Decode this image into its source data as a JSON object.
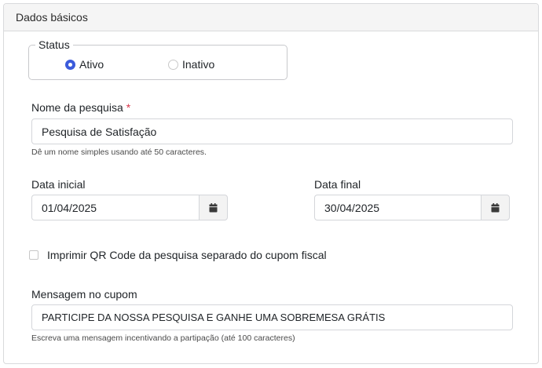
{
  "panel": {
    "title": "Dados básicos"
  },
  "status": {
    "legend": "Status",
    "options": [
      {
        "label": "Ativo",
        "selected": true
      },
      {
        "label": "Inativo",
        "selected": false
      }
    ]
  },
  "survey_name": {
    "label": "Nome da pesquisa",
    "required_mark": "*",
    "value": "Pesquisa de Satisfação",
    "help": "Dê um nome simples usando até 50 caracteres."
  },
  "start_date": {
    "label": "Data inicial",
    "value": "01/04/2025",
    "icon": "calendar-icon"
  },
  "end_date": {
    "label": "Data final",
    "value": "30/04/2025",
    "icon": "calendar-icon"
  },
  "print_qr": {
    "label": "Imprimir QR Code da pesquisa separado do cupom fiscal",
    "checked": false
  },
  "coupon_message": {
    "label": "Mensagem no cupom",
    "value": "PARTICIPE DA NOSSA PESQUISA E GANHE UMA SOBREMESA GRÁTIS",
    "help": "Escreva uma mensagem incentivando a partipação (até 100 caracteres)"
  },
  "colors": {
    "accent": "#3b5bdb",
    "required": "#d9364b",
    "header_bg": "#f5f5f5"
  }
}
